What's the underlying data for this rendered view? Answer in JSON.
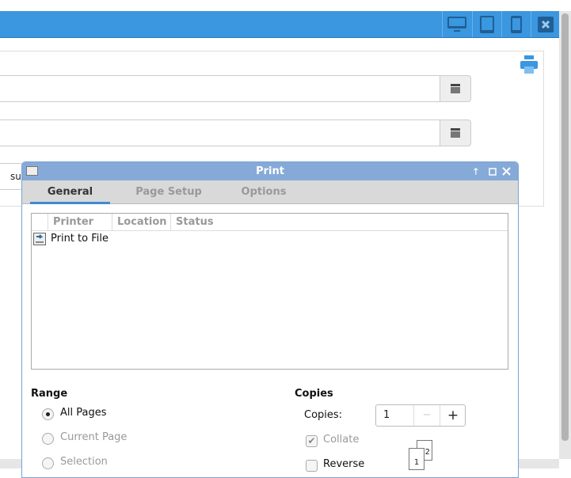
{
  "topbar": {
    "devices": [
      "desktop-icon",
      "tablet-icon",
      "phone-icon"
    ],
    "close_icon": "close-icon"
  },
  "form": {
    "submit_label": "su"
  },
  "dialog": {
    "title": "Print",
    "tabs": [
      {
        "label": "General"
      },
      {
        "label": "Page Setup"
      },
      {
        "label": "Options"
      }
    ],
    "columns": [
      "Printer",
      "Location",
      "Status"
    ],
    "printers": [
      {
        "name": "Print to File"
      }
    ],
    "range": {
      "heading": "Range",
      "options": [
        {
          "label": "All Pages",
          "selected": true,
          "enabled": true
        },
        {
          "label": "Current Page",
          "selected": false,
          "enabled": false
        },
        {
          "label": "Selection",
          "selected": false,
          "enabled": false
        }
      ]
    },
    "copies": {
      "heading": "Copies",
      "label": "Copies:",
      "value": "1",
      "minus": "−",
      "plus": "+",
      "collate_label": "Collate",
      "collate_checked": true,
      "reverse_label": "Reverse",
      "reverse_checked": false,
      "page_labels": [
        "1",
        "2"
      ]
    }
  },
  "colors": {
    "accent": "#3a97e0",
    "dialog_title": "#86aad8"
  }
}
